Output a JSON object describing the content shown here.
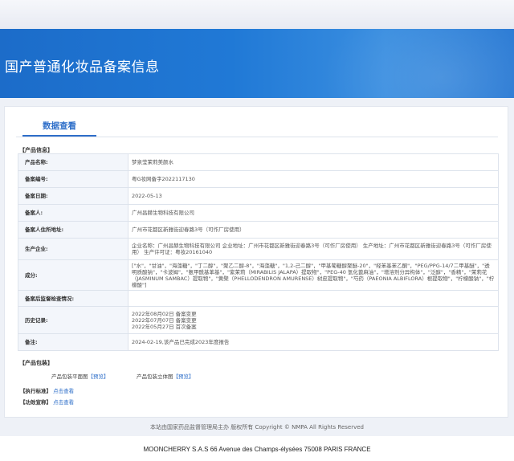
{
  "banner": {
    "title": "国产普通化妆品备案信息"
  },
  "tab": {
    "label": "数据查看"
  },
  "sections": {
    "product_info": "【产品信息】",
    "product_package": "【产品包装】",
    "standard": "【执行标准】",
    "efficacy": "【功效宣称】"
  },
  "rows": [
    {
      "label": "产品名称:",
      "value": "梦泉莹茉莉美颜水"
    },
    {
      "label": "备案编号:",
      "value": "粤G妆网备字2022117130"
    },
    {
      "label": "备案日期:",
      "value": "2022-05-13"
    },
    {
      "label": "备案人:",
      "value": "广州昌赫生物科技有限公司"
    },
    {
      "label": "备案人住所地址:",
      "value": "广州市花都区新雅街迎春路3号（可作厂房使用）"
    },
    {
      "label": "生产企业:",
      "value": "企业名称：广州昌赫生物科技有限公司 企业地址：广州市花都区新雅街迎春路3号（可作厂房使用） 生产地址：广州市花都区新雅街迎春路3号（可作厂房使用） 生产许可证：粤妆20161040"
    },
    {
      "label": "成分:",
      "value": "[\"水\"，\"甘油\"，\"海藻糖\"，\"丁二醇\"，\"聚乙二醇-8\"，\"海藻糖\"，\"1,2-己二醇\"，\"甲基葡糖醇聚醚-20\"，\"羟苯基苯乙酮\"，\"PEG/PPG-14/7二甲基醚\"，\"透明质酸钠\"，\"卡波姆\"，\"氨甲酰基苯基\"，\"紫茉莉（MIRABILIS JALAPA）提取物\"，\"PEG-40 氢化蓖麻油\"，\"增溶剂分异构体\"，\"泛醇\"，\"香精\"，\"茉莉花（JASMINUM SAMBAC）提取物\"，\"黄檗（PHELLODENDRON AMURENSE）树皮提取物\"，\"芍药（PAEONIA ALBIFLORA）根提取物\"，\"柠檬酸钠\"，\"柠檬酸\"]"
    },
    {
      "label": "备案后监督检查情况:",
      "value": ""
    },
    {
      "label": "历史记录:",
      "value_lines": [
        "2022年08月02日 备案变更",
        "2022年07月07日 备案变更",
        "2022年05月27日 首次备案"
      ]
    },
    {
      "label": "备注:",
      "value": "2024-02-19,该产品已完成2023年度报告"
    }
  ],
  "package": {
    "flat_label": "产品包装平面图",
    "flat_link": "【预览】",
    "solid_label": "产品包装立体图",
    "solid_link": "【预览】"
  },
  "links": {
    "standard_link": "点击查看",
    "efficacy_link": "点击查看"
  },
  "footer": {
    "copyright": "本站由国家药品监督管理局主办 版权所有 Copyright © NMPA All Rights Reserved",
    "brand": "MOONCHERRY S.A.S 66 Avenue des Champs-élysées 75008 PARIS FRANCE"
  }
}
